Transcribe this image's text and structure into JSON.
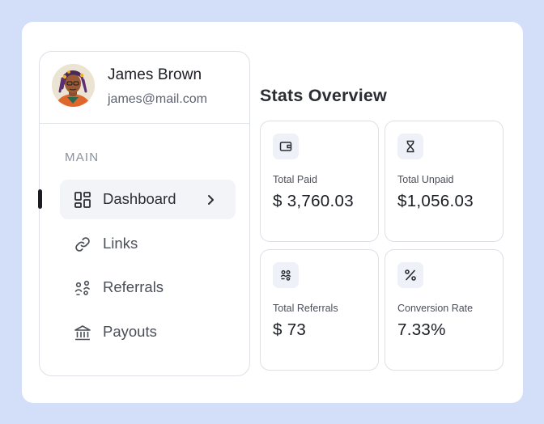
{
  "user": {
    "name": "James Brown",
    "email": "james@mail.com"
  },
  "sidebar": {
    "section_label": "MAIN",
    "items": [
      {
        "label": "Dashboard",
        "icon": "dashboard-grid-icon",
        "active": true
      },
      {
        "label": "Links",
        "icon": "link-icon",
        "active": false
      },
      {
        "label": "Referrals",
        "icon": "referrals-icon",
        "active": false
      },
      {
        "label": "Payouts",
        "icon": "bank-icon",
        "active": false
      }
    ]
  },
  "stats": {
    "title": "Stats Overview",
    "cards": [
      {
        "label": "Total Paid",
        "value": "$ 3,760.03",
        "icon": "wallet-icon"
      },
      {
        "label": "Total Unpaid",
        "value": "$1,056.03",
        "icon": "hourglass-icon"
      },
      {
        "label": "Total Referrals",
        "value": "$ 73",
        "icon": "referrals-icon"
      },
      {
        "label": "Conversion Rate",
        "value": "7.33%",
        "icon": "percent-icon"
      }
    ]
  },
  "colors": {
    "background": "#d3dff8",
    "card": "#ffffff",
    "border": "#dde0e6",
    "active_bg": "#f2f4f7",
    "text_primary": "#1b1d22",
    "text_secondary": "#5d6370"
  }
}
